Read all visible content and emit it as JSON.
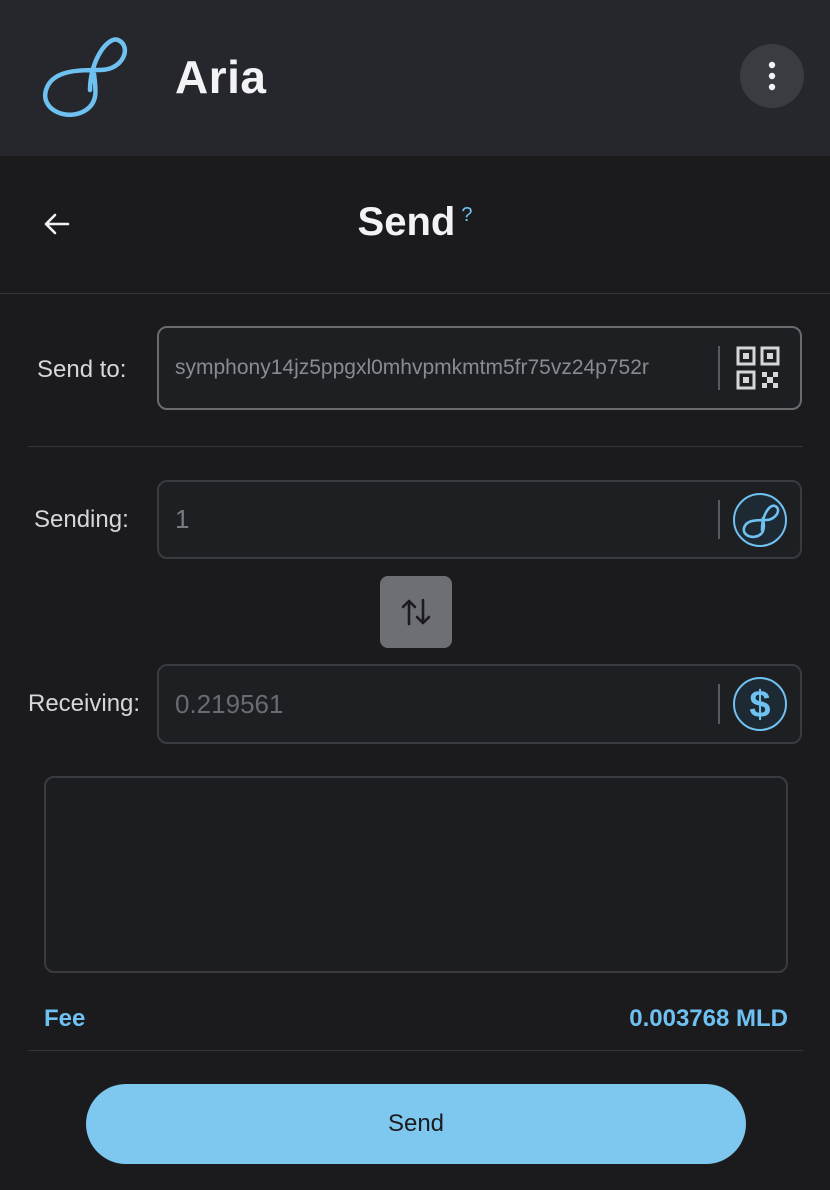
{
  "header": {
    "app_title": "Aria",
    "logo_icon": "aria-infinity-logo",
    "menu_icon": "more-vertical-icon"
  },
  "subheader": {
    "title": "Send",
    "help": "?",
    "back_icon": "arrow-left-icon"
  },
  "form": {
    "send_to_label": "Send to:",
    "send_to_value": "symphony14jz5ppgxl0mhvpmkmtm5fr75vz24p752r",
    "sending_label": "Sending:",
    "sending_value": "1",
    "receiving_label": "Receiving:",
    "receiving_value": "0.219561",
    "qr_icon": "qr-code-icon",
    "sending_token_icon": "aria-token-icon",
    "receiving_token_icon": "dollar-token-icon",
    "swap_icon": "swap-vertical-icon"
  },
  "fee": {
    "label": "Fee",
    "value": "0.003768 MLD"
  },
  "send_button": "Send",
  "colors": {
    "accent": "#6ec1f0",
    "button": "#7ec7ef",
    "background": "#1b1b1e",
    "header": "#25272d"
  }
}
